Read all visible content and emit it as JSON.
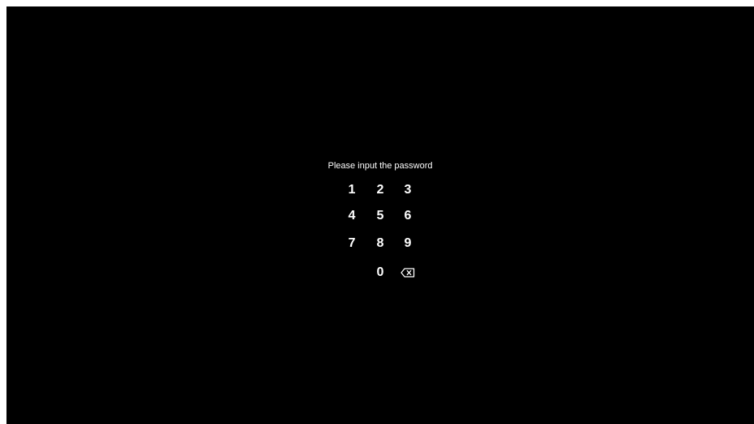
{
  "prompt": "Please input the password",
  "keypad": {
    "keys": [
      "1",
      "2",
      "3",
      "4",
      "5",
      "6",
      "7",
      "8",
      "9",
      "0"
    ],
    "backspace_icon": "backspace-icon"
  },
  "colors": {
    "screen_background": "#000000",
    "text": "#ffffff",
    "outer_border": "#ffffff"
  }
}
